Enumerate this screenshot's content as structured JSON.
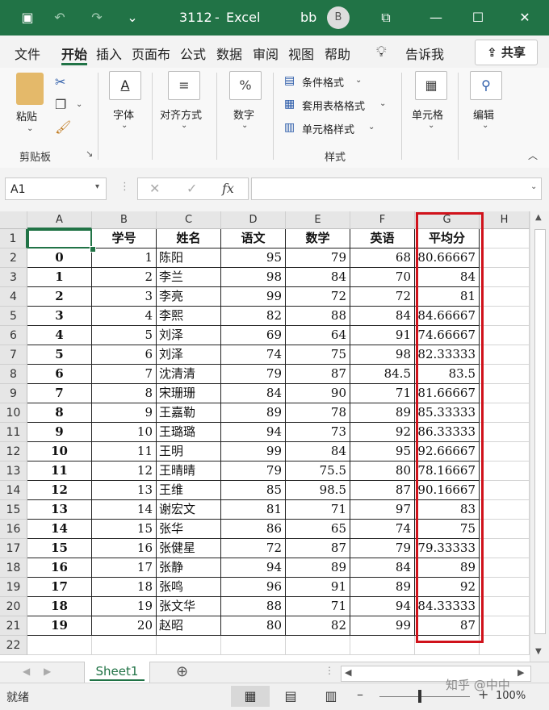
{
  "title_bar": {
    "workbook": "3112",
    "app": "Excel",
    "user": "bb",
    "avatar_initial": "B",
    "sep": "-"
  },
  "menu": {
    "items": [
      "文件",
      "开始",
      "插入",
      "页面布",
      "公式",
      "数据",
      "审阅",
      "视图",
      "帮助"
    ],
    "tell_me": "告诉我",
    "share": "共享"
  },
  "ribbon": {
    "paste": "粘贴",
    "font": "字体",
    "align": "对齐方式",
    "number": "数字",
    "conditional": "条件格式",
    "table_format": "套用表格格式",
    "cell_style": "单元格样式",
    "cells": "单元格",
    "edit": "编辑",
    "group_clipboard": "剪贴板",
    "group_style": "样式"
  },
  "formula_bar": {
    "name_box": "A1",
    "fx": "fx",
    "value": ""
  },
  "sheet": {
    "col_headers": [
      "A",
      "B",
      "C",
      "D",
      "E",
      "F",
      "G",
      "H"
    ],
    "header_row": [
      "",
      "学号",
      "姓名",
      "语文",
      "数学",
      "英语",
      "平均分"
    ],
    "rows": [
      [
        "0",
        "1",
        "陈阳",
        "95",
        "79",
        "68",
        "80.66667"
      ],
      [
        "1",
        "2",
        "李兰",
        "98",
        "84",
        "70",
        "84"
      ],
      [
        "2",
        "3",
        "李亮",
        "99",
        "72",
        "72",
        "81"
      ],
      [
        "3",
        "4",
        "李熙",
        "82",
        "88",
        "84",
        "84.66667"
      ],
      [
        "4",
        "5",
        "刘泽",
        "69",
        "64",
        "91",
        "74.66667"
      ],
      [
        "5",
        "6",
        "刘泽",
        "74",
        "75",
        "98",
        "82.33333"
      ],
      [
        "6",
        "7",
        "沈清清",
        "79",
        "87",
        "84.5",
        "83.5"
      ],
      [
        "7",
        "8",
        "宋珊珊",
        "84",
        "90",
        "71",
        "81.66667"
      ],
      [
        "8",
        "9",
        "王嘉勒",
        "89",
        "78",
        "89",
        "85.33333"
      ],
      [
        "9",
        "10",
        "王璐璐",
        "94",
        "73",
        "92",
        "86.33333"
      ],
      [
        "10",
        "11",
        "王明",
        "99",
        "84",
        "95",
        "92.66667"
      ],
      [
        "11",
        "12",
        "王晴晴",
        "79",
        "75.5",
        "80",
        "78.16667"
      ],
      [
        "12",
        "13",
        "王维",
        "85",
        "98.5",
        "87",
        "90.16667"
      ],
      [
        "13",
        "14",
        "谢宏文",
        "81",
        "71",
        "97",
        "83"
      ],
      [
        "14",
        "15",
        "张华",
        "86",
        "65",
        "74",
        "75"
      ],
      [
        "15",
        "16",
        "张健星",
        "72",
        "87",
        "79",
        "79.33333"
      ],
      [
        "16",
        "17",
        "张静",
        "94",
        "89",
        "84",
        "89"
      ],
      [
        "17",
        "18",
        "张鸣",
        "96",
        "91",
        "89",
        "92"
      ],
      [
        "18",
        "19",
        "张文华",
        "88",
        "71",
        "94",
        "84.33333"
      ],
      [
        "19",
        "20",
        "赵昭",
        "80",
        "82",
        "99",
        "87"
      ]
    ],
    "row_numbers": [
      "1",
      "2",
      "3",
      "4",
      "5",
      "6",
      "7",
      "8",
      "9",
      "10",
      "11",
      "12",
      "13",
      "14",
      "15",
      "16",
      "17",
      "18",
      "19",
      "20",
      "21",
      "22"
    ],
    "tab": "Sheet1"
  },
  "status": {
    "ready": "就绪",
    "zoom": "100%"
  },
  "watermark": "知乎 @中中",
  "colors": {
    "accent": "#217346",
    "highlight": "#d0121b"
  }
}
